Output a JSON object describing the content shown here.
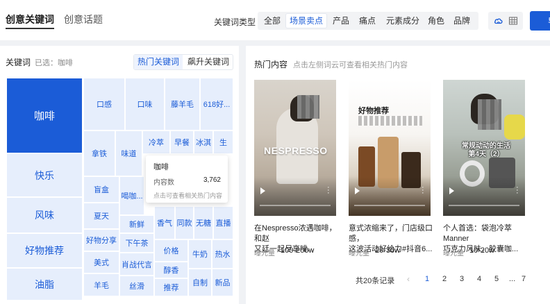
{
  "main_tabs": {
    "creative_keywords": "创意关键词",
    "creative_topics": "创意话题"
  },
  "keyword_type_label": "关键词类型",
  "keyword_filters": [
    "全部",
    "场景卖点",
    "产品",
    "痛点",
    "元素成分",
    "角色",
    "品牌"
  ],
  "active_filter": "场景卖点",
  "edge_button_text": "导",
  "left": {
    "title": "关键词",
    "selected": "已选：咖啡",
    "toggle": {
      "hot": "热门关键词",
      "rising": "飙升关键词"
    },
    "treemap": [
      "咖啡",
      "快乐",
      "风味",
      "好物推荐",
      "油脂",
      "口感",
      "口味",
      "藤羊毛",
      "618好...",
      "拿铁",
      "味道",
      "冷萃",
      "早餐",
      "冰淇",
      "生",
      "盲盒",
      "喝咖...",
      "夏天",
      "新鲜",
      "香气",
      "同款",
      "无糖",
      "直播",
      "好物分享",
      "下午茶",
      "美式",
      "肖战代言",
      "价格",
      "牛奶",
      "热水",
      "醇香",
      "羊毛",
      "丝滑",
      "推荐",
      "自制",
      "新品"
    ]
  },
  "tooltip": {
    "title": "咖啡",
    "label": "内容数",
    "value": "3,762",
    "hint": "点击可查看相关热门内容"
  },
  "right": {
    "title": "热门内容",
    "hint": "点击左侧词云可查看相关热门内容",
    "cards": [
      {
        "overlay": "NESPRESSO",
        "title_line1": "在Nespresso浓遇咖啡，和赵",
        "title_line2": "又廷一起尽享啡...",
        "exposure_label": "曝光量",
        "exposure": "100-200w"
      },
      {
        "overlay": "好物推荐",
        "title_line1": "意式浓缩来了，门店级口感，",
        "title_line2": "这波活动好给力#抖音6...",
        "exposure_label": "曝光量",
        "exposure": "20-30w"
      },
      {
        "overlay": "常规动动的生活",
        "overlay2": "第4天（2）",
        "title_line1": "个人首选：袋泡冷萃Manner",
        "title_line2": "巧克力风味，胶囊咖...",
        "exposure_label": "曝光量",
        "exposure": "10-20w"
      }
    ],
    "records": "共20条记录",
    "pages": [
      "1",
      "2",
      "3",
      "4",
      "5",
      "...",
      "7"
    ]
  }
}
